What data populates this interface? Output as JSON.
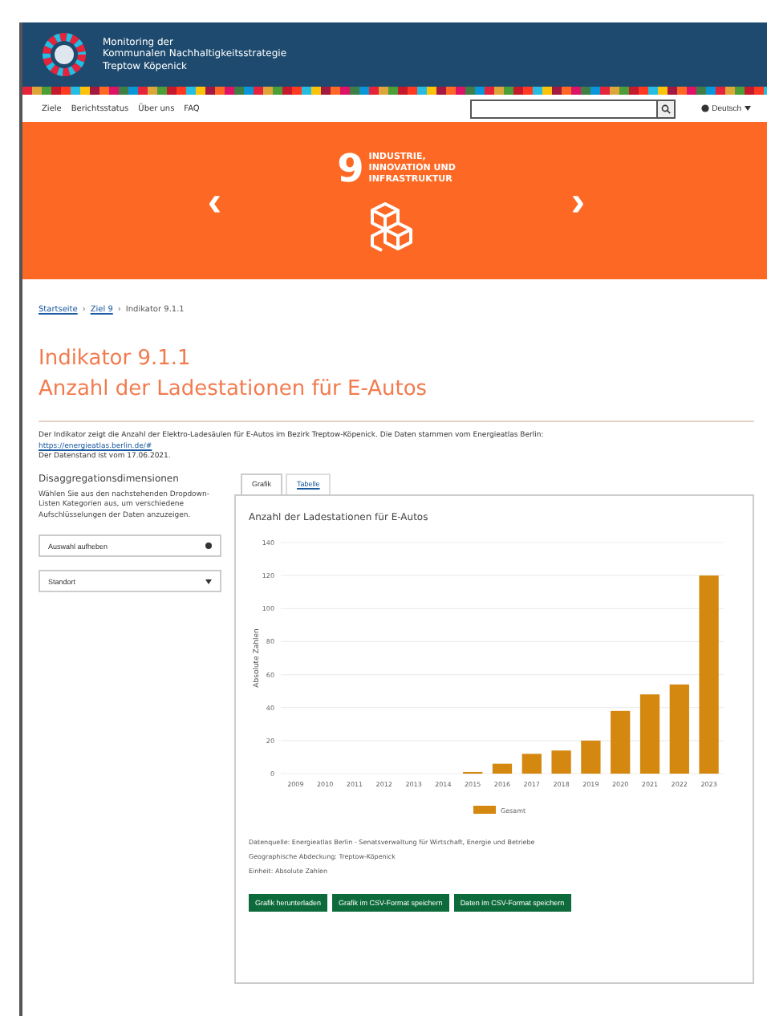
{
  "header": {
    "title_lines": [
      "Monitoring der",
      "Kommunalen Nachhaltigkeitsstrategie",
      "Treptow Köpenick"
    ]
  },
  "nav": {
    "items": [
      "Ziele",
      "Berichtsstatus",
      "Über uns",
      "FAQ"
    ],
    "language": "Deutsch"
  },
  "goal_banner": {
    "number": "9",
    "title_lines": [
      "INDUSTRIE,",
      "INNOVATION UND",
      "INFRASTRUKTUR"
    ],
    "prev": "‹",
    "next": "›"
  },
  "breadcrumb": [
    {
      "label": "Startseite",
      "link": true
    },
    {
      "label": "Ziel 9",
      "link": true
    },
    {
      "label": "Indikator 9.1.1",
      "link": false
    }
  ],
  "breadcrumb_separator": "›",
  "indicator": {
    "number": "Indikator 9.1.1",
    "title": "Anzahl der Ladestationen für E-Autos"
  },
  "description": {
    "text": "Der Indikator zeigt die Anzahl der Elektro-Ladesäulen für E-Autos im Bezirk Treptow-Köpenick. Die Daten stammen vom Energieatlas Berlin:",
    "link": "https://energieatlas.berlin.de/#",
    "date": "Der Datenstand ist vom 17.06.2021."
  },
  "disaggregation": {
    "title": "Disaggregationsdimensionen",
    "hint": "Wählen Sie aus den nachstehenden Dropdown-Listen Kategorien aus, um verschiedene Aufschlüsselungen der Daten anzuzeigen.",
    "selects": [
      {
        "value": "Auswahl aufheben",
        "kind": "clear"
      },
      {
        "value": "Standort",
        "kind": "dropdown"
      }
    ]
  },
  "tabs": [
    {
      "label": "Grafik",
      "selected": true
    },
    {
      "label": "Tabelle",
      "selected": false
    }
  ],
  "chart": {
    "chart_data": {
      "type": "bar",
      "title": "Anzahl der Ladestationen für E-Autos",
      "ylabel": "Absolute Zahlen",
      "categories": [
        "2009",
        "2010",
        "2011",
        "2012",
        "2013",
        "2014",
        "2015",
        "2016",
        "2017",
        "2018",
        "2019",
        "2020",
        "2021",
        "2022",
        "2023"
      ],
      "series": [
        {
          "name": "Gesamt",
          "color": "#d4880f",
          "values": [
            0,
            0,
            0,
            0,
            0,
            0,
            1,
            6,
            12,
            14,
            20,
            38,
            48,
            54,
            120
          ]
        }
      ],
      "ylim": [
        0,
        140
      ],
      "grid": true,
      "yticks": [
        0,
        20,
        40,
        60,
        80,
        100,
        120,
        140
      ]
    }
  },
  "footnotes": [
    "Datenquelle: Energieatlas Berlin - Senatsverwaltung für Wirtschaft, Energie und Betriebe",
    "Geographische Abdeckung: Treptow-Köpenick",
    "Einheit: Absolute Zahlen"
  ],
  "buttons": [
    "Grafik herunterladen",
    "Grafik im CSV-Format speichern",
    "Daten im CSV-Format speichern"
  ]
}
